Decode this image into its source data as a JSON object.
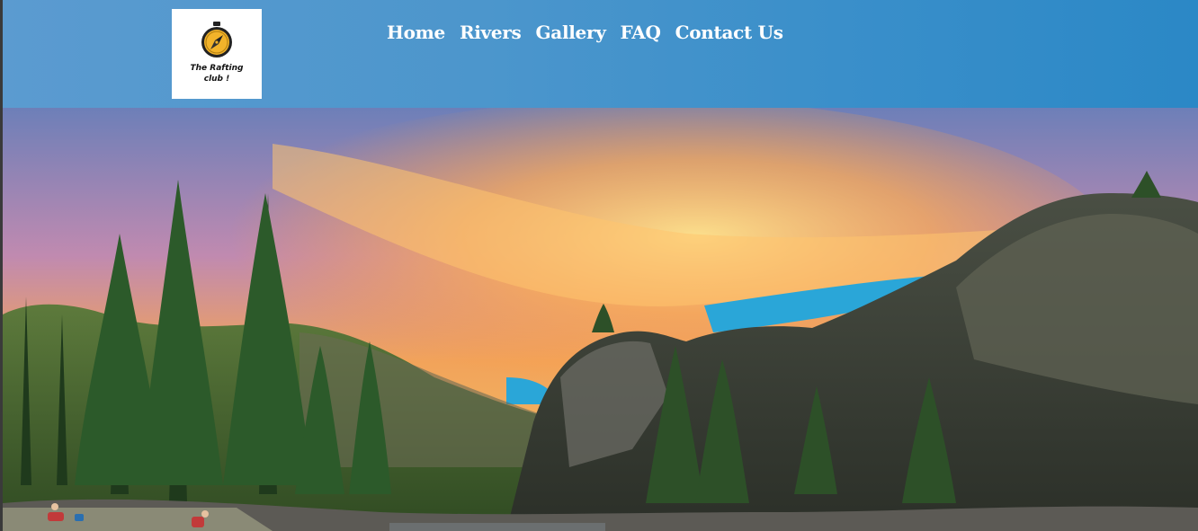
{
  "logo": {
    "text_line1": "The Rafting",
    "text_line2": "club !",
    "icon": "compass-icon"
  },
  "nav": {
    "items": [
      {
        "label": "Home"
      },
      {
        "label": "Rivers"
      },
      {
        "label": "Gallery"
      },
      {
        "label": "FAQ"
      },
      {
        "label": "Contact Us"
      }
    ]
  },
  "hero": {
    "scene": "river-canyon-sunset-photo"
  },
  "colors": {
    "header_blue": "#4c96cc",
    "nav_text": "#ffffff",
    "logo_badge": "#f2b32a"
  }
}
